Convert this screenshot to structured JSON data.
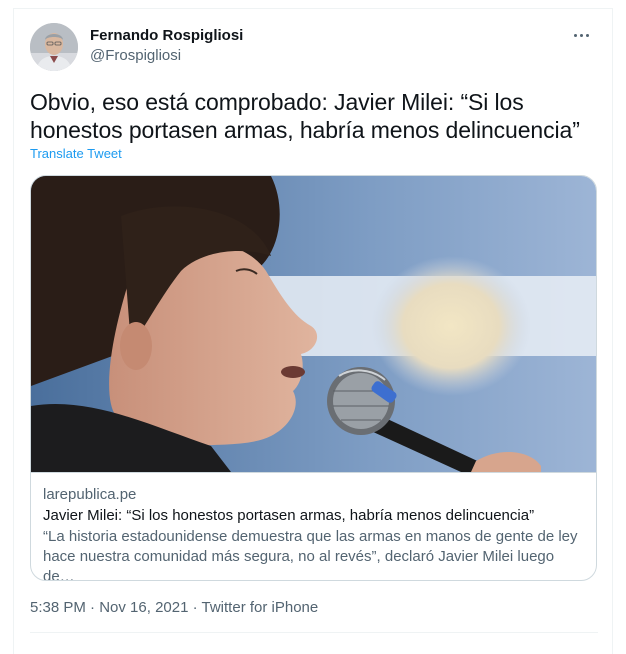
{
  "author": {
    "display_name": "Fernando Rospigliosi",
    "handle": "@Frospigliosi",
    "avatar_icon": "user-avatar"
  },
  "more_icon": "more-horizontal-icon",
  "tweet": {
    "text": "Obvio, eso está comprobado: Javier Milei: “Si los honestos portasen armas, habría menos delincuencia”",
    "translate_label": "Translate Tweet"
  },
  "card": {
    "domain": "larepublica.pe",
    "title": "Javier Milei: “Si los honestos portasen armas, habría menos delincuencia”",
    "description": "“La historia estadounidense demuestra que las armas en manos de gente de ley hace nuestra comunidad más segura, no al revés”, declaró Javier Milei luego de…"
  },
  "meta": {
    "time": "5:38 PM",
    "separator": " · ",
    "date": "Nov 16, 2021",
    "source": "Twitter for iPhone"
  },
  "colors": {
    "link": "#1d9bf0",
    "secondary_text": "#536471",
    "border": "#cfd9de"
  }
}
